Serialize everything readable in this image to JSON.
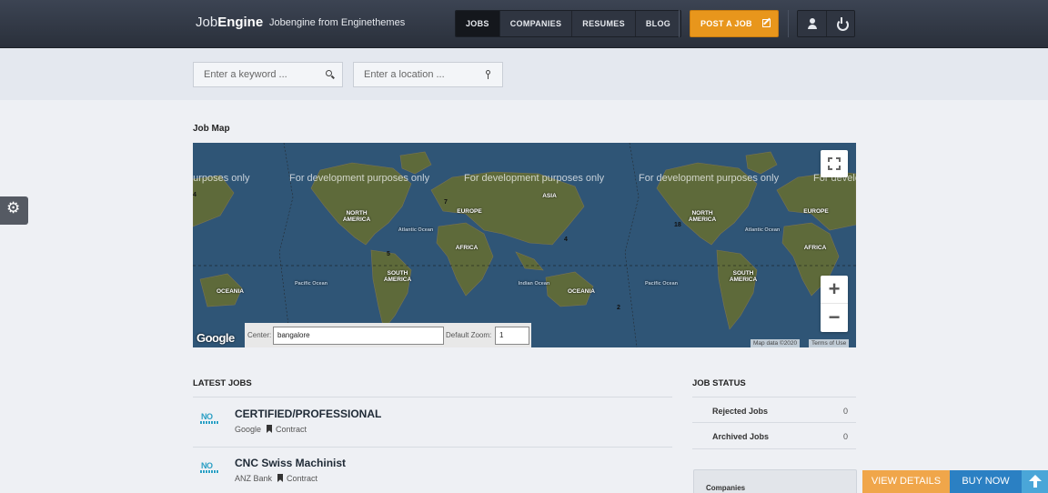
{
  "header": {
    "brand_light": "Job",
    "brand_bold": "Engine",
    "tagline": "Jobengine from Enginethemes",
    "nav": [
      {
        "label": "JOBS",
        "active": true
      },
      {
        "label": "COMPANIES",
        "active": false
      },
      {
        "label": "RESUMES",
        "active": false
      },
      {
        "label": "BLOG",
        "active": false
      }
    ],
    "post_job_label": "POST A JOB",
    "icons": [
      "user-icon",
      "power-icon",
      "edit-icon"
    ]
  },
  "search": {
    "keyword_placeholder": "Enter a keyword ...",
    "location_placeholder": "Enter a location ..."
  },
  "settings_icon": "gear-icon",
  "map": {
    "title": "Job Map",
    "watermark": "For development purposes only",
    "watermark_partial": "purposes only",
    "labels": {
      "north_america_1": "NORTH AMERICA",
      "north_america_2": "NORTH AMERICA",
      "south_america_1": "SOUTH AMERICA",
      "south_america_2": "SOUTH AMERICA",
      "europe_1": "EUROPE",
      "europe_2": "EUROPE",
      "africa_1": "AFRICA",
      "africa_2": "AFRICA",
      "asia": "ASIA",
      "oceania_1": "OCEANIA",
      "oceania_2": "OCEANIA",
      "atlantic_1": "Atlantic Ocean",
      "atlantic_2": "Atlantic Ocean",
      "pacific_1": "Pacific Ocean",
      "pacific_2": "Pacific Ocean",
      "indian": "Indian Ocean"
    },
    "clusters": [
      "4",
      "7",
      "5",
      "4",
      "2",
      "18"
    ],
    "zoom_in": "+",
    "zoom_out": "−",
    "center_label": "Center:",
    "center_value": "bangalore",
    "default_zoom_label": "Default Zoom:",
    "default_zoom_value": "1",
    "google_logo": "Google",
    "attribution": "Map data ©2020",
    "terms": "Terms of Use"
  },
  "latest_jobs": {
    "title": "LATEST JOBS",
    "logo_text": "NO",
    "items": [
      {
        "title": "CERTIFIED/PROFESSIONAL",
        "company": "Google",
        "type": "Contract"
      },
      {
        "title": "CNC Swiss Machinist",
        "company": "ANZ Bank",
        "type": "Contract"
      }
    ]
  },
  "job_status": {
    "title": "JOB STATUS",
    "rows": [
      {
        "label": "Rejected Jobs",
        "value": "0"
      },
      {
        "label": "Archived Jobs",
        "value": "0"
      }
    ],
    "companies_label": "Companies"
  },
  "promo": {
    "view_details": "VIEW DETAILS",
    "buy_now": "BUY NOW"
  },
  "colors": {
    "header_bg": "#2f3541",
    "accent_orange": "#e8961c",
    "ocean": "#2f5576",
    "buy_blue": "#2b80c3"
  }
}
